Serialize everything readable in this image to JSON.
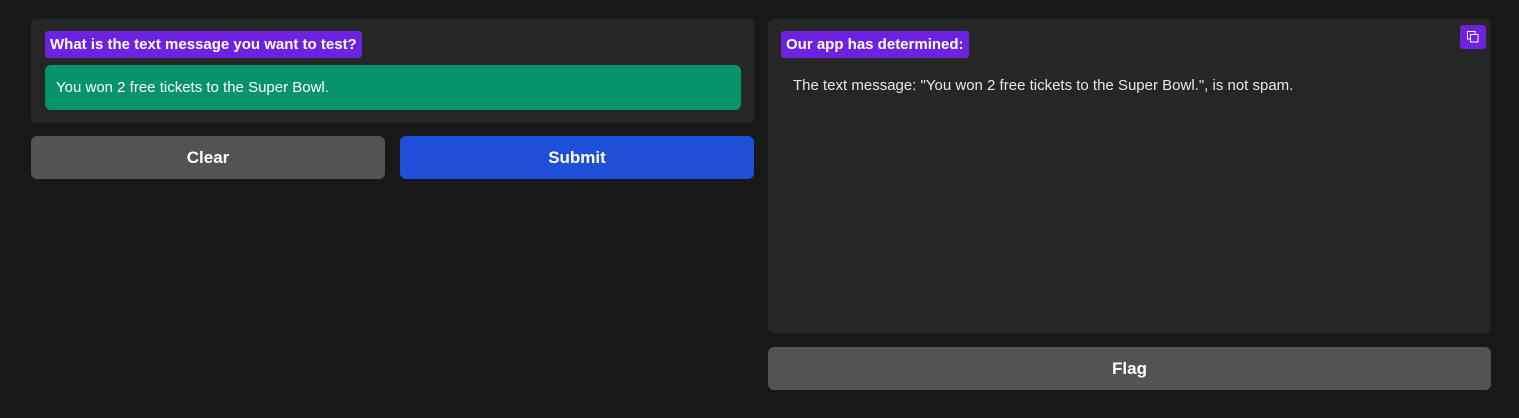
{
  "input_panel": {
    "label": "What is the text message you want to test?",
    "value": "You won 2 free tickets to the Super Bowl."
  },
  "output_panel": {
    "label": "Our app has determined:",
    "result": "The text message: \"You won 2 free tickets to the Super Bowl.\", is not spam.",
    "copy_icon": "copy-icon"
  },
  "buttons": {
    "clear": "Clear",
    "submit": "Submit",
    "flag": "Flag"
  },
  "colors": {
    "background": "#181818",
    "panel": "#262626",
    "label_chip": "#6d22e0",
    "input_fill": "#07946a",
    "submit": "#1f4fd8",
    "secondary_button": "#535353"
  }
}
